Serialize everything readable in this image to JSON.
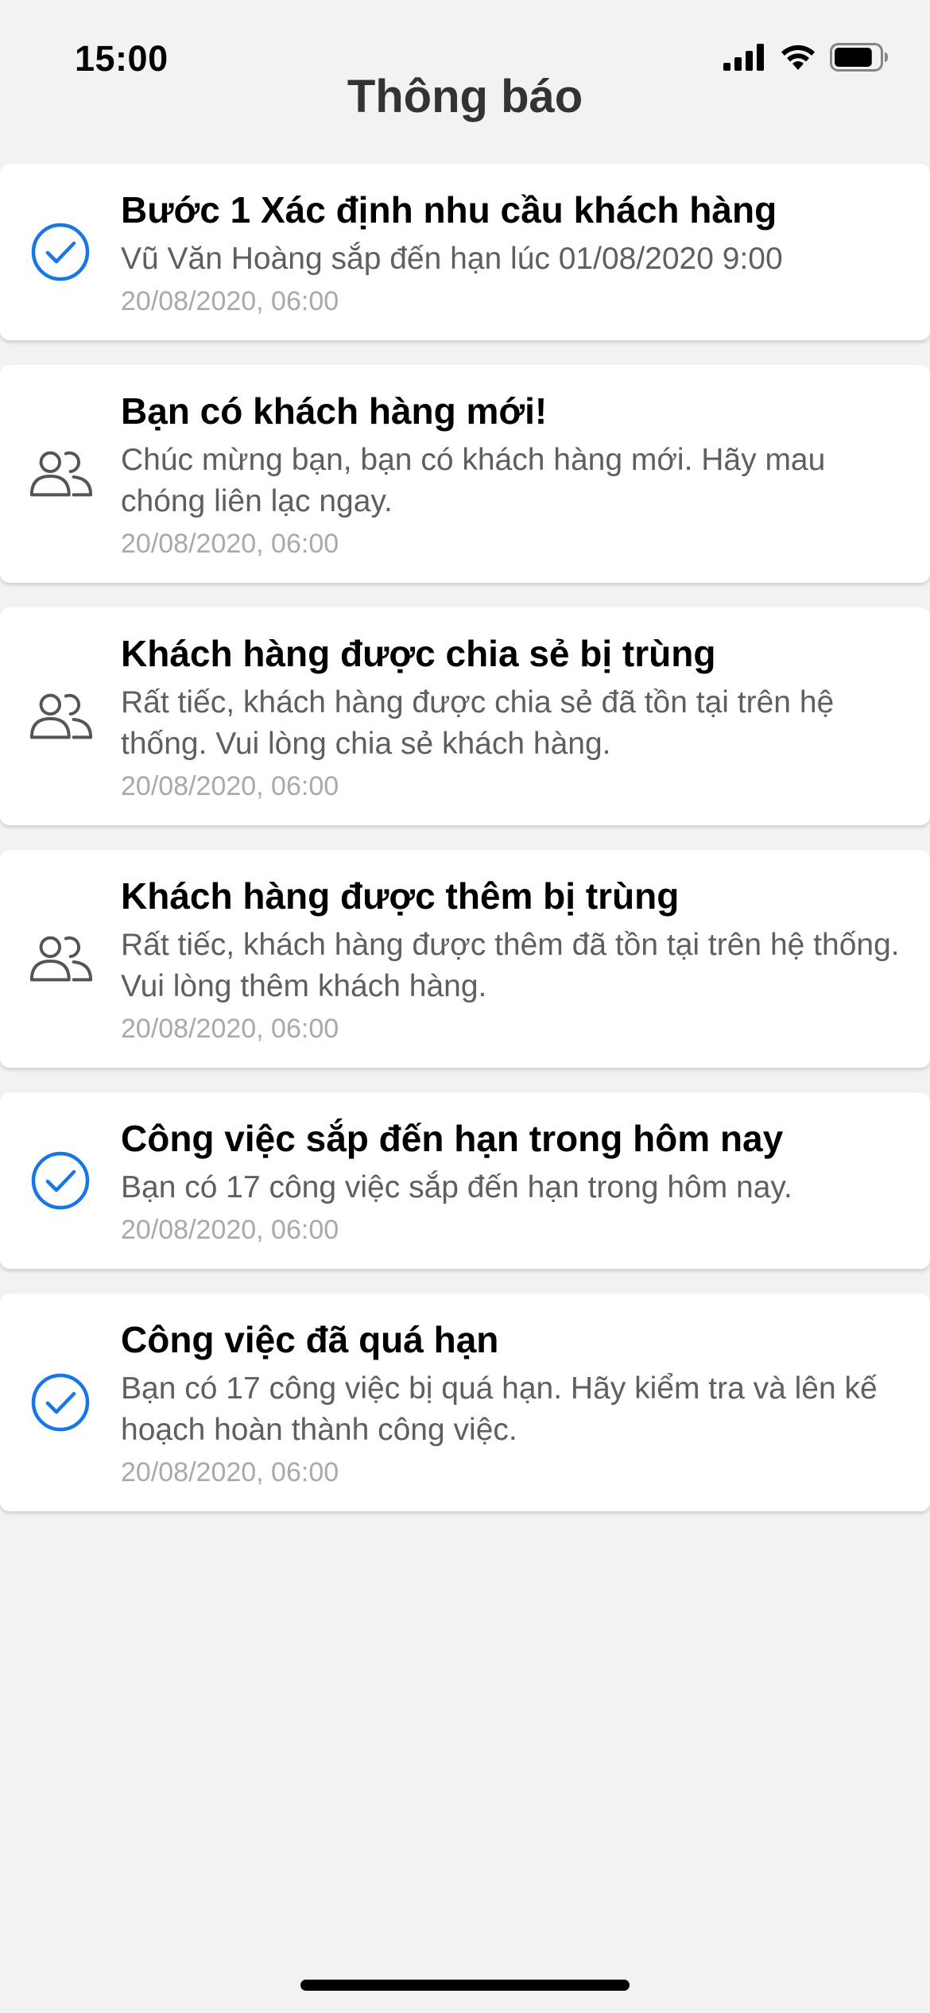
{
  "status_bar": {
    "time": "15:00",
    "icons": [
      "cellular-signal-icon",
      "wifi-icon",
      "battery-icon"
    ],
    "battery_level": 0.85
  },
  "header": {
    "title": "Thông báo"
  },
  "notifications": [
    {
      "icon": "check-circle-icon",
      "title": "Bước 1 Xác định nhu cầu khách hàng",
      "body": "Vũ Văn Hoàng sắp đến hạn lúc 01/08/2020 9:00",
      "time": "20/08/2020, 06:00"
    },
    {
      "icon": "users-icon",
      "title": "Bạn có khách hàng mới!",
      "body": "Chúc mừng bạn, bạn có khách hàng mới. Hãy mau chóng liên lạc ngay.",
      "time": "20/08/2020, 06:00"
    },
    {
      "icon": "users-icon",
      "title": "Khách hàng được chia sẻ bị trùng",
      "body": "Rất tiếc, khách hàng được chia sẻ đã tồn tại trên hệ thống. Vui lòng chia sẻ khách hàng.",
      "time": "20/08/2020, 06:00"
    },
    {
      "icon": "users-icon",
      "title": "Khách hàng được thêm bị trùng",
      "body": "Rất tiếc, khách hàng được thêm đã tồn tại trên hệ thống. Vui lòng thêm khách hàng.",
      "time": "20/08/2020, 06:00"
    },
    {
      "icon": "check-circle-icon",
      "title": "Công việc sắp đến hạn trong hôm nay",
      "body": "Bạn có 17 công việc sắp đến hạn trong hôm nay.",
      "time": "20/08/2020, 06:00"
    },
    {
      "icon": "check-circle-icon",
      "title": "Công việc đã quá hạn",
      "body": "Bạn có 17 công việc bị quá hạn. Hãy kiểm tra và lên kế hoạch hoàn thành công việc.",
      "time": "20/08/2020, 06:00"
    }
  ],
  "colors": {
    "accent": "#1877e6",
    "icon_gray": "#555555",
    "background": "#f2f2f3"
  }
}
